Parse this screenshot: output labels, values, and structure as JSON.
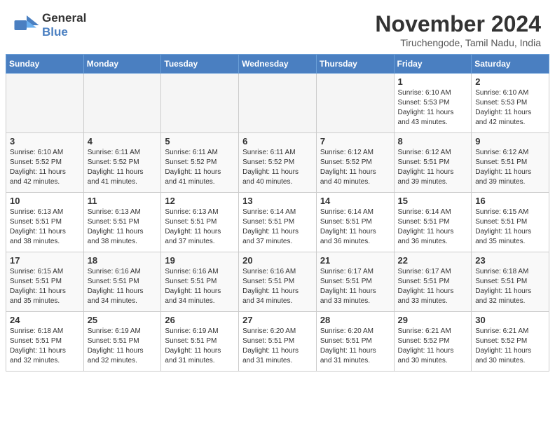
{
  "header": {
    "logo_general": "General",
    "logo_blue": "Blue",
    "month": "November 2024",
    "location": "Tiruchengode, Tamil Nadu, India"
  },
  "weekdays": [
    "Sunday",
    "Monday",
    "Tuesday",
    "Wednesday",
    "Thursday",
    "Friday",
    "Saturday"
  ],
  "weeks": [
    [
      {
        "day": "",
        "info": ""
      },
      {
        "day": "",
        "info": ""
      },
      {
        "day": "",
        "info": ""
      },
      {
        "day": "",
        "info": ""
      },
      {
        "day": "",
        "info": ""
      },
      {
        "day": "1",
        "info": "Sunrise: 6:10 AM\nSunset: 5:53 PM\nDaylight: 11 hours\nand 43 minutes."
      },
      {
        "day": "2",
        "info": "Sunrise: 6:10 AM\nSunset: 5:53 PM\nDaylight: 11 hours\nand 42 minutes."
      }
    ],
    [
      {
        "day": "3",
        "info": "Sunrise: 6:10 AM\nSunset: 5:52 PM\nDaylight: 11 hours\nand 42 minutes."
      },
      {
        "day": "4",
        "info": "Sunrise: 6:11 AM\nSunset: 5:52 PM\nDaylight: 11 hours\nand 41 minutes."
      },
      {
        "day": "5",
        "info": "Sunrise: 6:11 AM\nSunset: 5:52 PM\nDaylight: 11 hours\nand 41 minutes."
      },
      {
        "day": "6",
        "info": "Sunrise: 6:11 AM\nSunset: 5:52 PM\nDaylight: 11 hours\nand 40 minutes."
      },
      {
        "day": "7",
        "info": "Sunrise: 6:12 AM\nSunset: 5:52 PM\nDaylight: 11 hours\nand 40 minutes."
      },
      {
        "day": "8",
        "info": "Sunrise: 6:12 AM\nSunset: 5:51 PM\nDaylight: 11 hours\nand 39 minutes."
      },
      {
        "day": "9",
        "info": "Sunrise: 6:12 AM\nSunset: 5:51 PM\nDaylight: 11 hours\nand 39 minutes."
      }
    ],
    [
      {
        "day": "10",
        "info": "Sunrise: 6:13 AM\nSunset: 5:51 PM\nDaylight: 11 hours\nand 38 minutes."
      },
      {
        "day": "11",
        "info": "Sunrise: 6:13 AM\nSunset: 5:51 PM\nDaylight: 11 hours\nand 38 minutes."
      },
      {
        "day": "12",
        "info": "Sunrise: 6:13 AM\nSunset: 5:51 PM\nDaylight: 11 hours\nand 37 minutes."
      },
      {
        "day": "13",
        "info": "Sunrise: 6:14 AM\nSunset: 5:51 PM\nDaylight: 11 hours\nand 37 minutes."
      },
      {
        "day": "14",
        "info": "Sunrise: 6:14 AM\nSunset: 5:51 PM\nDaylight: 11 hours\nand 36 minutes."
      },
      {
        "day": "15",
        "info": "Sunrise: 6:14 AM\nSunset: 5:51 PM\nDaylight: 11 hours\nand 36 minutes."
      },
      {
        "day": "16",
        "info": "Sunrise: 6:15 AM\nSunset: 5:51 PM\nDaylight: 11 hours\nand 35 minutes."
      }
    ],
    [
      {
        "day": "17",
        "info": "Sunrise: 6:15 AM\nSunset: 5:51 PM\nDaylight: 11 hours\nand 35 minutes."
      },
      {
        "day": "18",
        "info": "Sunrise: 6:16 AM\nSunset: 5:51 PM\nDaylight: 11 hours\nand 34 minutes."
      },
      {
        "day": "19",
        "info": "Sunrise: 6:16 AM\nSunset: 5:51 PM\nDaylight: 11 hours\nand 34 minutes."
      },
      {
        "day": "20",
        "info": "Sunrise: 6:16 AM\nSunset: 5:51 PM\nDaylight: 11 hours\nand 34 minutes."
      },
      {
        "day": "21",
        "info": "Sunrise: 6:17 AM\nSunset: 5:51 PM\nDaylight: 11 hours\nand 33 minutes."
      },
      {
        "day": "22",
        "info": "Sunrise: 6:17 AM\nSunset: 5:51 PM\nDaylight: 11 hours\nand 33 minutes."
      },
      {
        "day": "23",
        "info": "Sunrise: 6:18 AM\nSunset: 5:51 PM\nDaylight: 11 hours\nand 32 minutes."
      }
    ],
    [
      {
        "day": "24",
        "info": "Sunrise: 6:18 AM\nSunset: 5:51 PM\nDaylight: 11 hours\nand 32 minutes."
      },
      {
        "day": "25",
        "info": "Sunrise: 6:19 AM\nSunset: 5:51 PM\nDaylight: 11 hours\nand 32 minutes."
      },
      {
        "day": "26",
        "info": "Sunrise: 6:19 AM\nSunset: 5:51 PM\nDaylight: 11 hours\nand 31 minutes."
      },
      {
        "day": "27",
        "info": "Sunrise: 6:20 AM\nSunset: 5:51 PM\nDaylight: 11 hours\nand 31 minutes."
      },
      {
        "day": "28",
        "info": "Sunrise: 6:20 AM\nSunset: 5:51 PM\nDaylight: 11 hours\nand 31 minutes."
      },
      {
        "day": "29",
        "info": "Sunrise: 6:21 AM\nSunset: 5:52 PM\nDaylight: 11 hours\nand 30 minutes."
      },
      {
        "day": "30",
        "info": "Sunrise: 6:21 AM\nSunset: 5:52 PM\nDaylight: 11 hours\nand 30 minutes."
      }
    ]
  ]
}
